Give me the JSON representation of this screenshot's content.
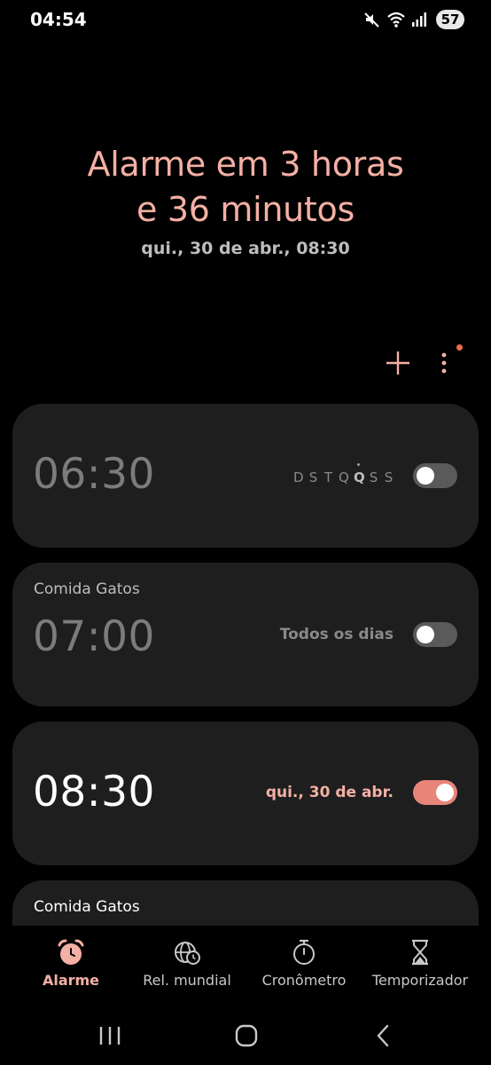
{
  "status_bar": {
    "time": "04:54",
    "battery": "57"
  },
  "header": {
    "title_line1": "Alarme em 3 horas",
    "title_line2": "e 36 minutos",
    "subtitle": "qui., 30 de abr., 08:30"
  },
  "toolbar": {
    "add_icon": "plus-icon",
    "more_icon": "more-vertical-icon"
  },
  "alarms": [
    {
      "label": "",
      "time": "06:30",
      "days": [
        "D",
        "S",
        "T",
        "Q",
        "Q",
        "S",
        "S"
      ],
      "today_index": 4,
      "enabled": false
    },
    {
      "label": "Comida Gatos",
      "time": "07:00",
      "repeat": "Todos os dias",
      "enabled": false
    },
    {
      "label": "",
      "time": "08:30",
      "repeat": "qui., 30 de abr.",
      "enabled": true
    },
    {
      "label": "Comida Gatos"
    }
  ],
  "bottom_nav": [
    {
      "label": "Alarme",
      "icon": "alarm-clock-icon",
      "active": true
    },
    {
      "label": "Rel. mundial",
      "icon": "globe-clock-icon",
      "active": false
    },
    {
      "label": "Cronômetro",
      "icon": "stopwatch-icon",
      "active": false
    },
    {
      "label": "Temporizador",
      "icon": "hourglass-icon",
      "active": false
    }
  ],
  "colors": {
    "accent": "#f4b0a4",
    "toggle_on": "#e7857a",
    "card_bg": "#1e1e1e",
    "notification_dot": "#f06a4a"
  }
}
